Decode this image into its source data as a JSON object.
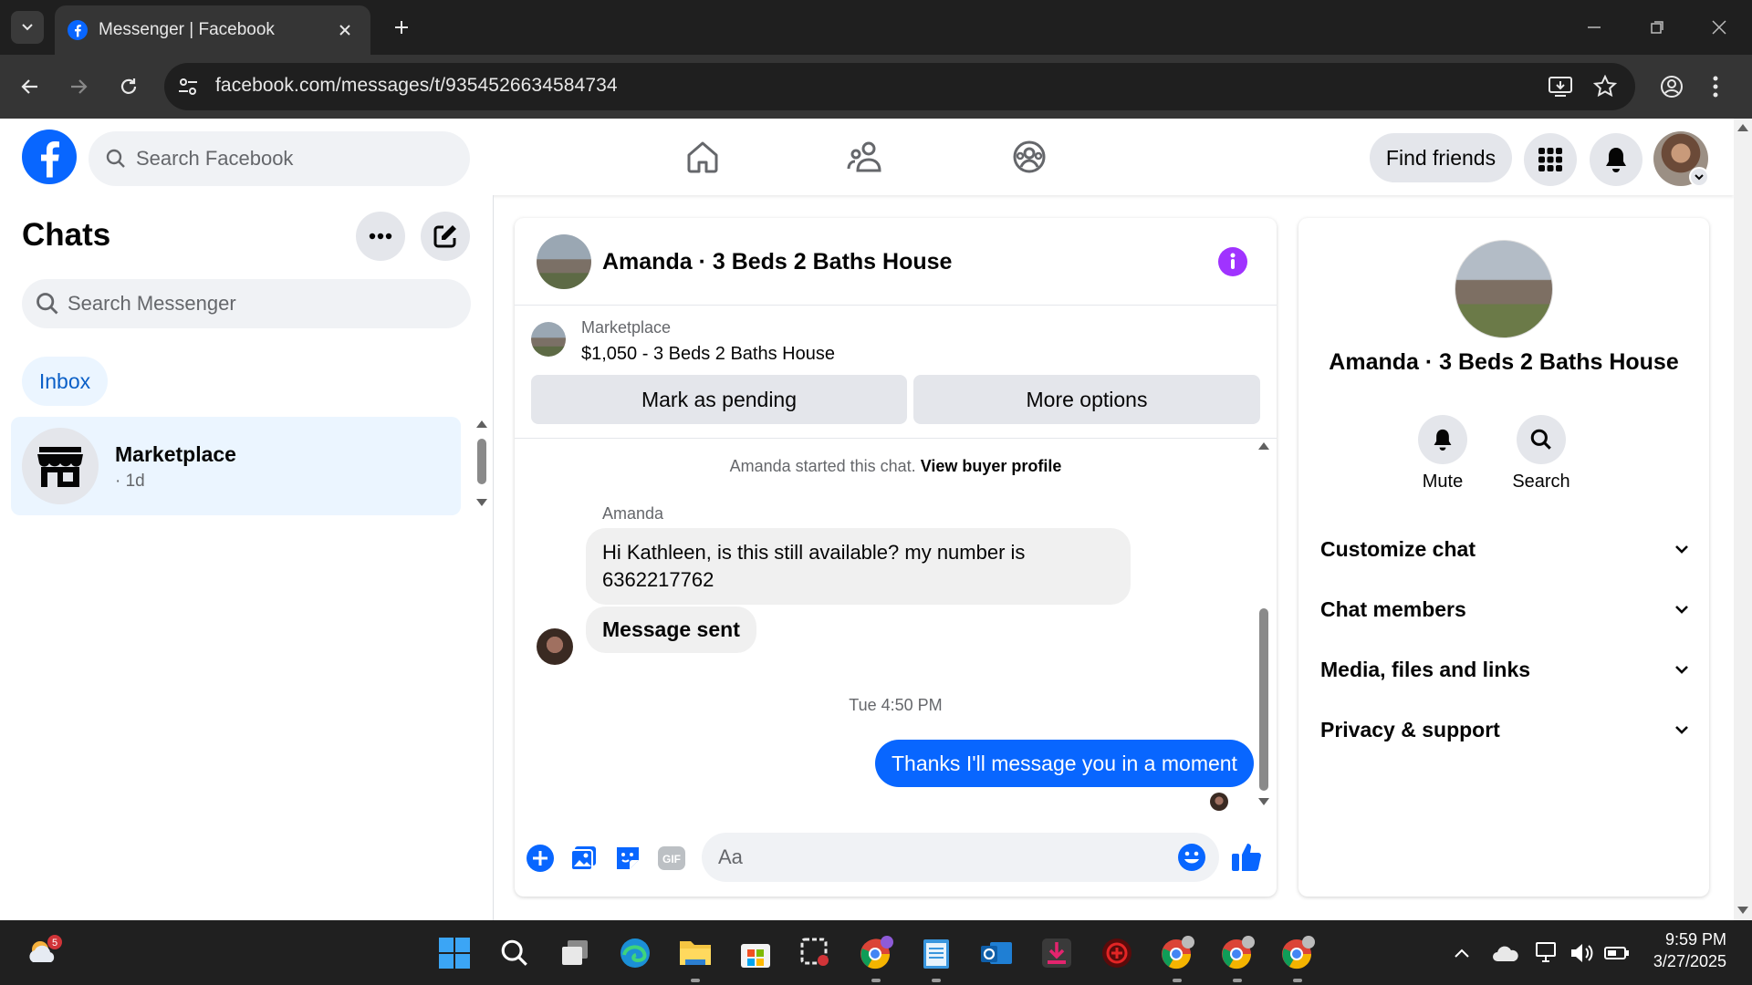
{
  "browser": {
    "tab_title": "Messenger | Facebook",
    "url": "facebook.com/messages/t/9354526634584734"
  },
  "header": {
    "search_placeholder": "Search Facebook",
    "find_friends_label": "Find friends"
  },
  "chats": {
    "title": "Chats",
    "search_placeholder": "Search Messenger",
    "inbox_label": "Inbox",
    "items": [
      {
        "name": "Marketplace",
        "time": "· 1d"
      }
    ]
  },
  "conversation": {
    "title": "Amanda · 3 Beds 2 Baths House",
    "listing": {
      "source": "Marketplace",
      "price_title": "$1,050 - 3 Beds 2 Baths House",
      "mark_pending": "Mark as pending",
      "more_options": "More options"
    },
    "started_text": "Amanda started this chat.",
    "view_buyer_profile": "View buyer profile",
    "sender": "Amanda",
    "messages": [
      {
        "text": "Hi Kathleen, is this still available? my number is 6362217762",
        "from": "them"
      },
      {
        "text": "Message sent",
        "from": "them"
      },
      {
        "text": "Thanks I'll message you in a moment",
        "from": "me"
      }
    ],
    "timestamp": "Tue 4:50 PM",
    "composer_placeholder": "Aa"
  },
  "info_panel": {
    "title": "Amanda · 3 Beds 2 Baths House",
    "actions": [
      {
        "label": "Mute"
      },
      {
        "label": "Search"
      }
    ],
    "sections": [
      {
        "label": "Customize chat"
      },
      {
        "label": "Chat members"
      },
      {
        "label": "Media, files and links"
      },
      {
        "label": "Privacy & support"
      }
    ]
  },
  "taskbar": {
    "weather_badge": "5",
    "clock_time": "9:59 PM",
    "clock_date": "3/27/2025"
  },
  "colors": {
    "fb_blue": "#0866ff",
    "info_purple": "#a033ff",
    "chat_selected": "#ebf5ff"
  }
}
